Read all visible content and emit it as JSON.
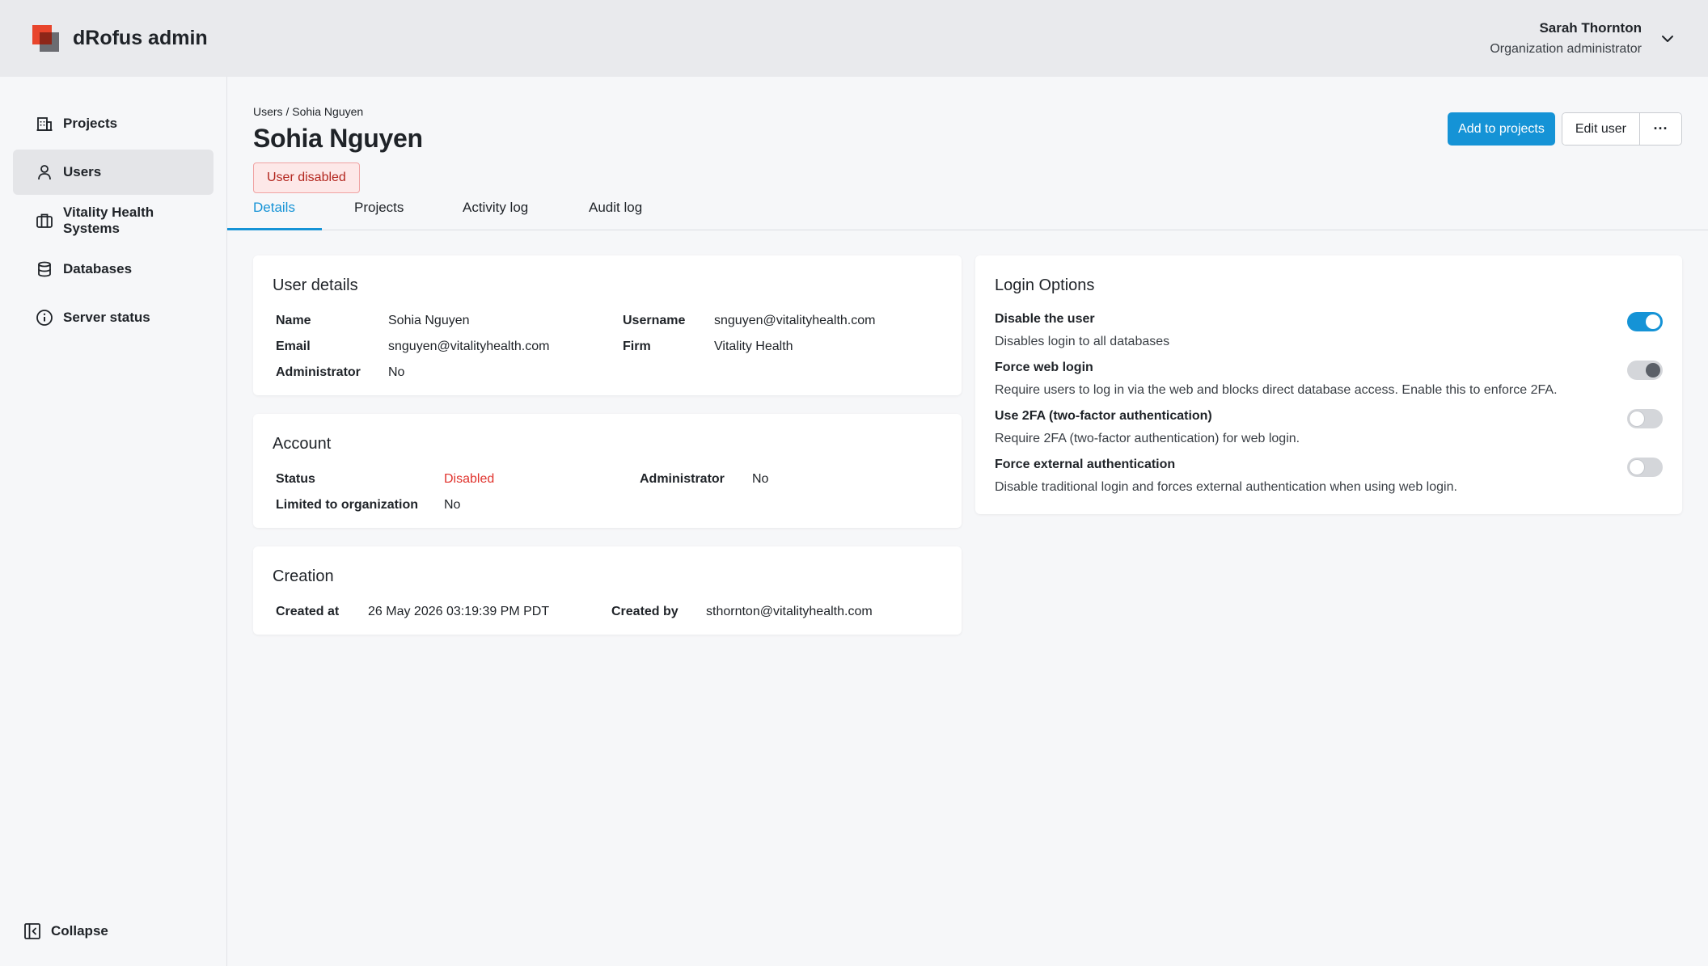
{
  "app": {
    "title": "dRofus admin"
  },
  "user_menu": {
    "name": "Sarah Thornton",
    "role": "Organization administrator"
  },
  "sidebar": {
    "items": [
      {
        "label": "Projects",
        "icon": "building-icon",
        "active": false
      },
      {
        "label": "Users",
        "icon": "user-icon",
        "active": true
      },
      {
        "label": "Vitality Health Systems",
        "icon": "briefcase-icon",
        "active": false
      },
      {
        "label": "Databases",
        "icon": "database-icon",
        "active": false
      },
      {
        "label": "Server status",
        "icon": "info-icon",
        "active": false
      }
    ],
    "collapse_label": "Collapse"
  },
  "page": {
    "breadcrumb": "Users / Sohia Nguyen",
    "title": "Sohia Nguyen",
    "status_badge": "User disabled",
    "actions": {
      "primary": "Add to projects",
      "edit": "Edit user",
      "more": "···"
    }
  },
  "tabs": [
    {
      "label": "Details",
      "active": true
    },
    {
      "label": "Projects",
      "active": false
    },
    {
      "label": "Activity log",
      "active": false
    },
    {
      "label": "Audit log",
      "active": false
    }
  ],
  "user_details": {
    "title": "User details",
    "name_label": "Name",
    "name_value": "Sohia Nguyen",
    "email_label": "Email",
    "email_value": "snguyen@vitalityhealth.com",
    "admin_label": "Administrator",
    "admin_value": "No",
    "username_label": "Username",
    "username_value": "snguyen@vitalityhealth.com",
    "firm_label": "Firm",
    "firm_value": "Vitality Health"
  },
  "account": {
    "title": "Account",
    "status_label": "Status",
    "status_value": "Disabled",
    "limited_label": "Limited to organization",
    "limited_value": "No",
    "admin_label": "Administrator",
    "admin_value": "No"
  },
  "creation": {
    "title": "Creation",
    "created_at_label": "Created at",
    "created_at_value": "26 May 2026 03:19:39 PM PDT",
    "created_by_label": "Created by",
    "created_by_value": "sthornton@vitalityhealth.com"
  },
  "login_options": {
    "title": "Login Options",
    "options": [
      {
        "title": "Disable the user",
        "description": "Disables login to all databases",
        "state": "on"
      },
      {
        "title": "Force web login",
        "description": "Require users to log in via the web and blocks direct database access. Enable this to enforce 2FA.",
        "state": "on-disabled"
      },
      {
        "title": "Use 2FA (two-factor authentication)",
        "description": "Require 2FA (two-factor authentication) for web login.",
        "state": "off"
      },
      {
        "title": "Force external authentication",
        "description": "Disable traditional login and forces external authentication when using web login.",
        "state": "off"
      }
    ]
  },
  "colors": {
    "accent": "#1593d6",
    "danger": "#e0322c",
    "brand_red": "#e8452c"
  }
}
